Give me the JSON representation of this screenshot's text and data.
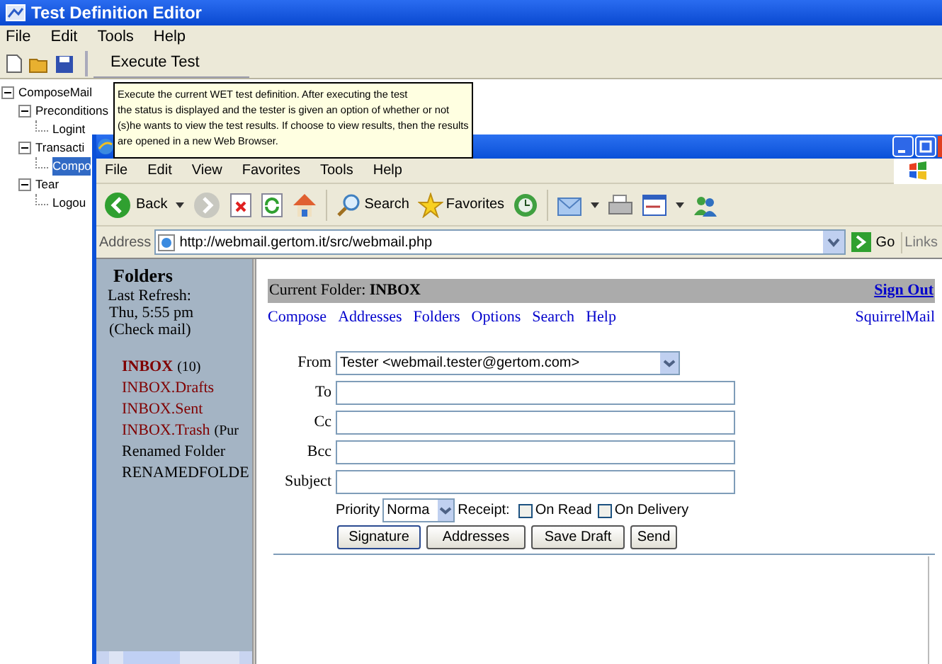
{
  "editor_window": {
    "title": "Test Definition Editor",
    "menu": [
      "File",
      "Edit",
      "Tools",
      "Help"
    ],
    "execute_button": "Execute Test",
    "tree": [
      {
        "label": "ComposeMail",
        "expanded": true,
        "selected": false,
        "children": [
          {
            "label": "Preconditions",
            "expanded": true,
            "selected": false,
            "children": [
              {
                "label": "Logint",
                "selected": false
              }
            ]
          },
          {
            "label": "Transacti",
            "expanded": true,
            "selected": false,
            "children": [
              {
                "label": "Compo",
                "selected": true
              }
            ]
          },
          {
            "label": "Tear",
            "expanded": true,
            "selected": false,
            "children": [
              {
                "label": "Logou",
                "selected": false
              }
            ]
          }
        ]
      }
    ]
  },
  "tooltip": {
    "text": "Execute the current WET test definition. After executing the test\nthe status is displayed and the tester is given an option of whether or not\n(s)he wants to view the test results. If choose to view results, then the results\nare opened in a new Web Browser."
  },
  "browser_window": {
    "menu": [
      "File",
      "Edit",
      "View",
      "Favorites",
      "Tools",
      "Help"
    ],
    "toolbar": {
      "back": "Back",
      "search": "Search",
      "favorites": "Favorites"
    },
    "address": {
      "label": "Address",
      "url": "http://webmail.gertom.it/src/webmail.php",
      "go": "Go",
      "links": "Links"
    },
    "folders_pane": {
      "title": "Folders",
      "refresh_label": "Last Refresh:",
      "refresh_time": "Thu, 5:55 pm",
      "check_mail": "(Check mail)",
      "folders": [
        {
          "label": "INBOX",
          "note": "(10)",
          "color": "#800000",
          "bold": true
        },
        {
          "label": "INBOX.Drafts",
          "color": "#800000",
          "bold": false
        },
        {
          "label": "INBOX.Sent",
          "color": "#800000",
          "bold": false
        },
        {
          "label": "INBOX.Trash",
          "note": "(Pur",
          "color": "#800000",
          "bold": false
        },
        {
          "label": "Renamed Folder",
          "color": "#000000",
          "bold": false
        },
        {
          "label": "RENAMEDFOLDE",
          "color": "#000000",
          "bold": false
        }
      ]
    },
    "compose": {
      "current_folder_label": "Current Folder:",
      "current_folder": "INBOX",
      "sign_out": "Sign Out",
      "nav": [
        "Compose",
        "Addresses",
        "Folders",
        "Options",
        "Search",
        "Help"
      ],
      "brand": "SquirrelMail",
      "from": {
        "label": "From",
        "value": "Tester <webmail.tester@gertom.com>"
      },
      "fields": [
        {
          "label": "To"
        },
        {
          "label": "Cc"
        },
        {
          "label": "Bcc"
        },
        {
          "label": "Subject"
        }
      ],
      "priority": {
        "label": "Priority",
        "value": "Norma"
      },
      "receipt": "Receipt:",
      "receipt_options": [
        {
          "label": "On Read",
          "checked": false
        },
        {
          "label": "On Delivery",
          "checked": false
        }
      ],
      "buttons": [
        "Signature",
        "Addresses",
        "Save Draft",
        "Send"
      ]
    }
  }
}
